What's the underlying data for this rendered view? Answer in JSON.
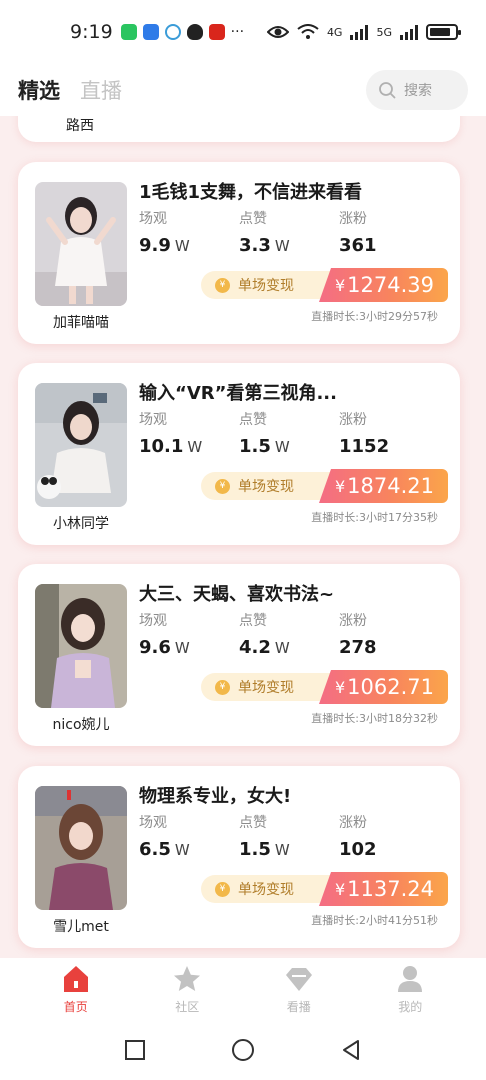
{
  "status_bar": {
    "time": "9:19",
    "more": "···",
    "network_4g": "4G",
    "network_5g": "5G"
  },
  "header": {
    "tabs": [
      {
        "label": "精选"
      },
      {
        "label": "直播"
      }
    ],
    "search": {
      "placeholder": "搜索"
    }
  },
  "partial_card": {
    "name": "路西"
  },
  "stat_labels": {
    "views": "场观",
    "likes": "点赞",
    "fans": "涨粉",
    "unit": "W"
  },
  "earnings_label": "单场变现",
  "currency": "¥",
  "cards": [
    {
      "name": "加菲喵喵",
      "title": "1毛钱1支舞，不信进来看看",
      "views": "9.9",
      "likes": "3.3",
      "fans": "361",
      "earnings": "1274.39",
      "duration": "直播时长:3小时29分57秒"
    },
    {
      "name": "小林同学",
      "title": "输入“VR”看第三视角...",
      "views": "10.1",
      "likes": "1.5",
      "fans": "1152",
      "earnings": "1874.21",
      "duration": "直播时长:3小时17分35秒"
    },
    {
      "name": "nico婉儿",
      "title": "大三、天蝎、喜欢书法~",
      "views": "9.6",
      "likes": "4.2",
      "fans": "278",
      "earnings": "1062.71",
      "duration": "直播时长:3小时18分32秒"
    },
    {
      "name": "雪儿met",
      "title": "物理系专业，女大!",
      "views": "6.5",
      "likes": "1.5",
      "fans": "102",
      "earnings": "1137.24",
      "duration": "直播时长:2小时41分51秒"
    }
  ],
  "bottom_nav": [
    {
      "label": "首页",
      "icon": "home-icon",
      "active": true
    },
    {
      "label": "社区",
      "icon": "star-icon",
      "active": false
    },
    {
      "label": "看播",
      "icon": "diamond-icon",
      "active": false
    },
    {
      "label": "我的",
      "icon": "profile-icon",
      "active": false
    }
  ],
  "colors": {
    "accent": "#e8413d",
    "earn_gradient_start": "#f46d84",
    "earn_gradient_end": "#fba54a",
    "background": "#fbeeee"
  }
}
